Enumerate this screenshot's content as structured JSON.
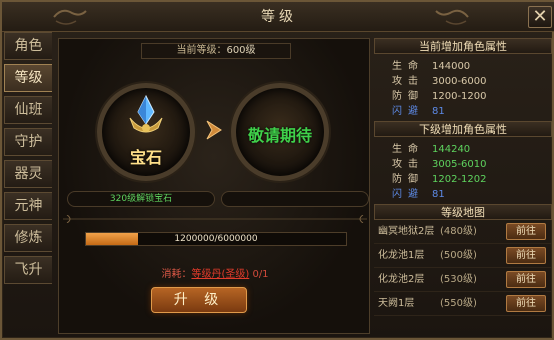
{
  "window": {
    "title": "等级",
    "close_label": "✕"
  },
  "sidebar": {
    "tabs": [
      {
        "label": "角色",
        "active": false
      },
      {
        "label": "等级",
        "active": true
      },
      {
        "label": "仙班",
        "active": false
      },
      {
        "label": "守护",
        "active": false
      },
      {
        "label": "器灵",
        "active": false
      },
      {
        "label": "元神",
        "active": false
      },
      {
        "label": "修炼",
        "active": false
      },
      {
        "label": "飞升",
        "active": false
      }
    ]
  },
  "main": {
    "current_level_label": "当前等级：",
    "current_level_value": "600级",
    "gem_left_label": "宝石",
    "gem_right_label": "敬请期待",
    "unlock_left": "320级解锁宝石",
    "unlock_right": "",
    "exp_text": "1200000/6000000",
    "exp_fraction": 0.2,
    "cost_label": "消耗：",
    "cost_item": "等级丹(圣级)",
    "cost_amount": "0/1",
    "upgrade_label": "升 级"
  },
  "current_attrs": {
    "title": "当前增加角色属性",
    "rows": [
      {
        "key": "生命",
        "value": "144000",
        "key_color": "normal",
        "value_color": "normal"
      },
      {
        "key": "攻击",
        "value": "3000-6000",
        "key_color": "normal",
        "value_color": "normal"
      },
      {
        "key": "防御",
        "value": "1200-1200",
        "key_color": "normal",
        "value_color": "normal"
      },
      {
        "key": "闪避",
        "value": "81",
        "key_color": "blue",
        "value_color": "blue"
      }
    ]
  },
  "next_attrs": {
    "title": "下级增加角色属性",
    "rows": [
      {
        "key": "生命",
        "value": "144240",
        "key_color": "normal",
        "value_color": "green"
      },
      {
        "key": "攻击",
        "value": "3005-6010",
        "key_color": "normal",
        "value_color": "green"
      },
      {
        "key": "防御",
        "value": "1202-1202",
        "key_color": "normal",
        "value_color": "green"
      },
      {
        "key": "闪避",
        "value": "81",
        "key_color": "blue",
        "value_color": "blue"
      }
    ]
  },
  "map": {
    "title": "等级地图",
    "rows": [
      {
        "name": "幽冥地狱2层",
        "level": "(480级)",
        "button": "前往"
      },
      {
        "name": "化龙池1层",
        "level": "(500级)",
        "button": "前往"
      },
      {
        "name": "化龙池2层",
        "level": "(530级)",
        "button": "前往"
      },
      {
        "name": "天阙1层",
        "level": "(550级)",
        "button": "前往"
      }
    ]
  },
  "colors": {
    "accent_gold": "#ffe08a",
    "accent_green": "#3fd04a",
    "exp_orange": "#e58a2c",
    "attr_blue": "#5d8ae6",
    "cost_red": "#e23b2b"
  }
}
